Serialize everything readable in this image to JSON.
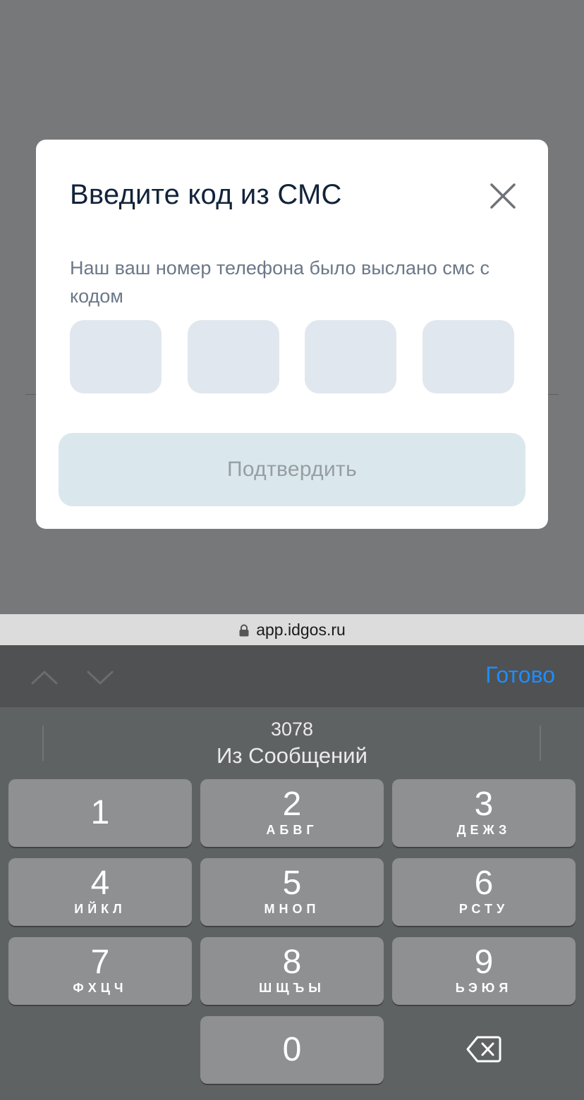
{
  "modal": {
    "title": "Введите код из СМС",
    "description": "Наш ваш номер телефона было выслано смс с кодом",
    "code_cells": [
      "",
      "",
      "",
      ""
    ],
    "confirm_label": "Подтвердить"
  },
  "browser": {
    "url": "app.idgos.ru"
  },
  "accessory": {
    "done_label": "Готово"
  },
  "keyboard": {
    "suggestion": {
      "code": "3078",
      "source": "Из Сообщений"
    },
    "keys": [
      {
        "num": "1",
        "letters": ""
      },
      {
        "num": "2",
        "letters": "АБВГ"
      },
      {
        "num": "3",
        "letters": "ДЕЖЗ"
      },
      {
        "num": "4",
        "letters": "ИЙКЛ"
      },
      {
        "num": "5",
        "letters": "МНОП"
      },
      {
        "num": "6",
        "letters": "РСТУ"
      },
      {
        "num": "7",
        "letters": "ФХЦЧ"
      },
      {
        "num": "8",
        "letters": "ШЩЪЫ"
      },
      {
        "num": "9",
        "letters": "ЬЭЮЯ"
      },
      {
        "num": "0",
        "letters": ""
      }
    ]
  },
  "colors": {
    "backdrop": "#77787a",
    "title": "#12233a",
    "cell_fill": "#e1e7ee",
    "confirm_fill": "#dae8ed",
    "done_accent": "#1e8dff",
    "key_fill": "#8e9091"
  },
  "icons": {
    "close": "close-icon",
    "lock": "lock-icon",
    "prev": "chevron-up-icon",
    "next": "chevron-down-icon",
    "delete": "backspace-icon"
  }
}
